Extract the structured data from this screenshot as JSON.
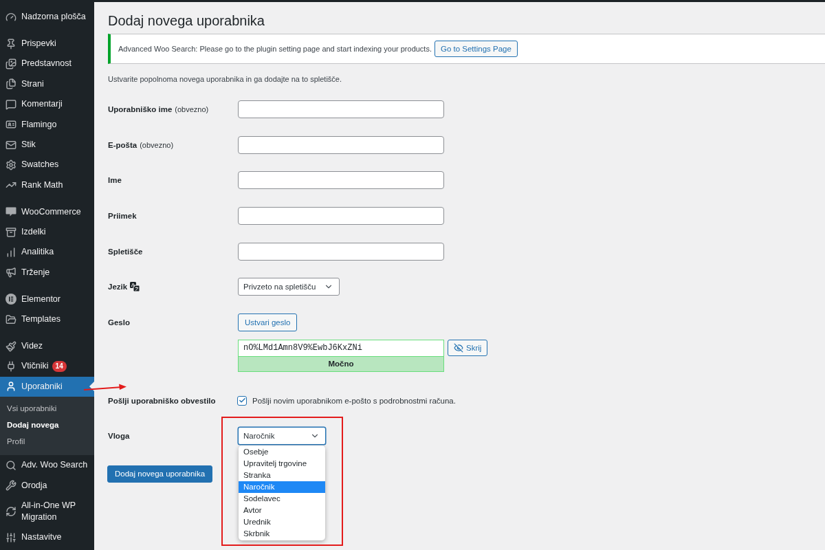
{
  "sidebar": {
    "groups": [
      {
        "items": [
          {
            "label": "Nadzorna plošča",
            "selected": false
          }
        ]
      },
      {
        "items": [
          {
            "label": "Prispevki",
            "selected": false
          },
          {
            "label": "Predstavnost",
            "selected": false
          },
          {
            "label": "Strani",
            "selected": false
          },
          {
            "label": "Komentarji",
            "selected": false
          },
          {
            "label": "Flamingo",
            "selected": false
          },
          {
            "label": "Stik",
            "selected": false
          },
          {
            "label": "Swatches",
            "selected": false
          },
          {
            "label": "Rank Math",
            "selected": false
          }
        ]
      },
      {
        "items": [
          {
            "label": "WooCommerce",
            "selected": false
          },
          {
            "label": "Izdelki",
            "selected": false
          },
          {
            "label": "Analitika",
            "selected": false
          },
          {
            "label": "Trženje",
            "selected": false
          }
        ]
      },
      {
        "items": [
          {
            "label": "Elementor",
            "selected": false
          },
          {
            "label": "Templates",
            "selected": false
          }
        ]
      },
      {
        "items": [
          {
            "label": "Videz",
            "selected": false
          },
          {
            "label": "Vtičniki",
            "selected": false,
            "badge": "14"
          },
          {
            "label": "Uporabniki",
            "selected": true,
            "submenu": [
              {
                "label": "Vsi uporabniki",
                "selected": false
              },
              {
                "label": "Dodaj novega",
                "selected": true
              },
              {
                "label": "Profil",
                "selected": false
              }
            ]
          },
          {
            "label": "Adv. Woo Search",
            "selected": false
          },
          {
            "label": "Orodja",
            "selected": false
          },
          {
            "label": "All-in-One WP Migration",
            "selected": false
          },
          {
            "label": "Nastavitve",
            "selected": false
          }
        ]
      }
    ]
  },
  "page": {
    "title": "Dodaj novega uporabnika",
    "notice": {
      "text": "Advanced Woo Search: Please go to the plugin setting page and start indexing your products.",
      "button": "Go to Settings Page"
    },
    "intro": "Ustvarite popolnoma novega uporabnika in ga dodajte na to spletišče.",
    "fields": [
      {
        "kind": "text",
        "label": "Uporabniško ime",
        "hint": "(obvezno)"
      },
      {
        "kind": "text",
        "label": "E-pošta",
        "hint": "(obvezno)"
      },
      {
        "kind": "text",
        "label": "Ime"
      },
      {
        "kind": "text",
        "label": "Priimek"
      },
      {
        "kind": "text",
        "label": "Spletišče"
      },
      {
        "kind": "select",
        "label": "Jezik",
        "value": "Privzeto na spletišču"
      },
      {
        "kind": "password",
        "label": "Geslo",
        "generate_button": "Ustvari geslo",
        "value": "nO%LMd1Amn8V9%EwbJ6KxZNi",
        "strength": "Močno",
        "toggle_button": "Skrij"
      },
      {
        "kind": "checkbox",
        "label": "Pošlji uporabniško obvestilo",
        "checked": true,
        "text": "Pošlji novim uporabnikom e-pošto s podrobnostmi računa."
      },
      {
        "kind": "dropdown",
        "label": "Vloga",
        "value": "Naročnik",
        "expanded": true,
        "options": [
          {
            "label": "Osebje",
            "selected": false
          },
          {
            "label": "Upravitelj trgovine",
            "selected": false
          },
          {
            "label": "Stranka",
            "selected": false
          },
          {
            "label": "Naročnik",
            "selected": true
          },
          {
            "label": "Sodelavec",
            "selected": false
          },
          {
            "label": "Avtor",
            "selected": false
          },
          {
            "label": "Urednik",
            "selected": false
          },
          {
            "label": "Skrbnik",
            "selected": false
          }
        ]
      }
    ],
    "submit_button": "Dodaj novega uporabnika"
  },
  "annotations": {
    "arrow": true,
    "frame": true
  }
}
